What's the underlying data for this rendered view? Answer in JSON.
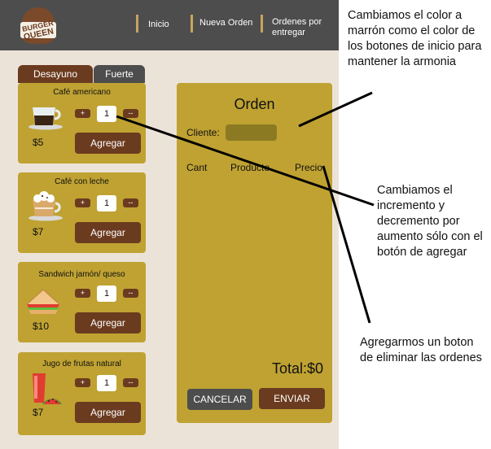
{
  "nav": {
    "logo_line1": "BURGER",
    "logo_line2": "QUEEN",
    "items": [
      {
        "label": "Inicio"
      },
      {
        "label": "Nueva Orden"
      },
      {
        "label": "Ordenes por entregar"
      }
    ]
  },
  "tabs": [
    {
      "label": "Desayuno"
    },
    {
      "label": "Fuerte"
    }
  ],
  "products": [
    {
      "name": "Café americano",
      "price": "$5",
      "qty": "1",
      "plus": "+",
      "minus": "--",
      "add": "Agregar"
    },
    {
      "name": "Café con leche",
      "price": "$7",
      "qty": "1",
      "plus": "+",
      "minus": "--",
      "add": "Agregar"
    },
    {
      "name": "Sandwich jamón/ queso",
      "price": "$10",
      "qty": "1",
      "plus": "+",
      "minus": "--",
      "add": "Agregar"
    },
    {
      "name": "Jugo de frutas natural",
      "price": "$7",
      "qty": "1",
      "plus": "+",
      "minus": "--",
      "add": "Agregar"
    }
  ],
  "order": {
    "title": "Orden",
    "client_label": "Cliente:",
    "client_value": "",
    "col_qty": "Cant",
    "col_product": "Producto",
    "col_price": "Precio",
    "total": "Total:$0",
    "cancel": "CANCELAR",
    "send": "ENVIAR"
  },
  "annotations": {
    "note1": "Cambiamos el color a marrón como el color de los botones de inicio para mantener la armonia",
    "note2": "Cambiamos el incremento y decremento por aumento sólo con el botón de agregar",
    "note3": "Agregarmos un boton de eliminar las ordenes"
  },
  "colors": {
    "header": "#4d4d4d",
    "brown": "#6b3b1f",
    "card": "#bfa232",
    "background": "#ece3d8",
    "nav_separator": "#c9a35e"
  }
}
